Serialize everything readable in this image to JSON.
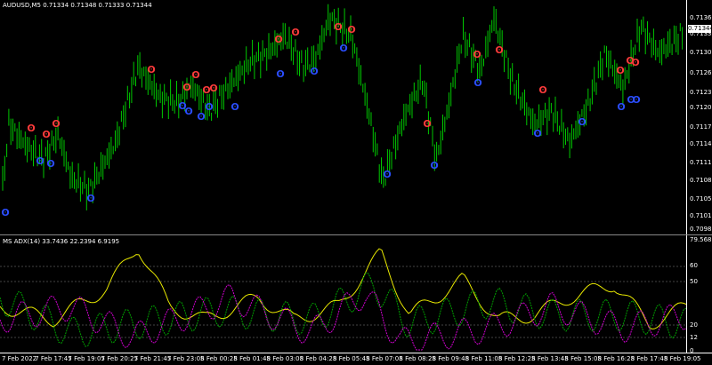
{
  "main_chart": {
    "header": "AUDUSD,M5  0.71334 0.71348 0.71333 0.71344",
    "price_ticks": [
      "0.71360",
      "0.71330",
      "0.71300",
      "0.71265",
      "0.71235",
      "0.71205",
      "0.71175",
      "0.71140",
      "0.71110",
      "0.71080",
      "0.71050",
      "0.71015",
      "0.70985"
    ],
    "current_price": "0.71344",
    "colors": {
      "candle": "#00c800",
      "up_fractal": "#ff3b3b",
      "down_fractal": "#2a4dff"
    }
  },
  "indicator": {
    "header": "MS ADX(14) 33.7436 22.2394 6.9195",
    "ticks": [
      "79.5683",
      "60",
      "50",
      "20",
      "12",
      "0"
    ],
    "colors": {
      "adx": "#e8e800",
      "plus_di": "#00a000",
      "minus_di": "#d000d0"
    }
  },
  "time_axis": [
    "7 Feb 2022",
    "7 Feb 17:45",
    "7 Feb 19:05",
    "7 Feb 20:25",
    "7 Feb 21:45",
    "7 Feb 23:05",
    "8 Feb 00:25",
    "8 Feb 01:45",
    "8 Feb 03:05",
    "8 Feb 04:25",
    "8 Feb 05:45",
    "8 Feb 07:05",
    "8 Feb 08:25",
    "8 Feb 09:45",
    "8 Feb 11:05",
    "8 Feb 12:25",
    "8 Feb 13:45",
    "8 Feb 15:05",
    "8 Feb 16:25",
    "8 Feb 17:45",
    "8 Feb 19:05"
  ]
}
